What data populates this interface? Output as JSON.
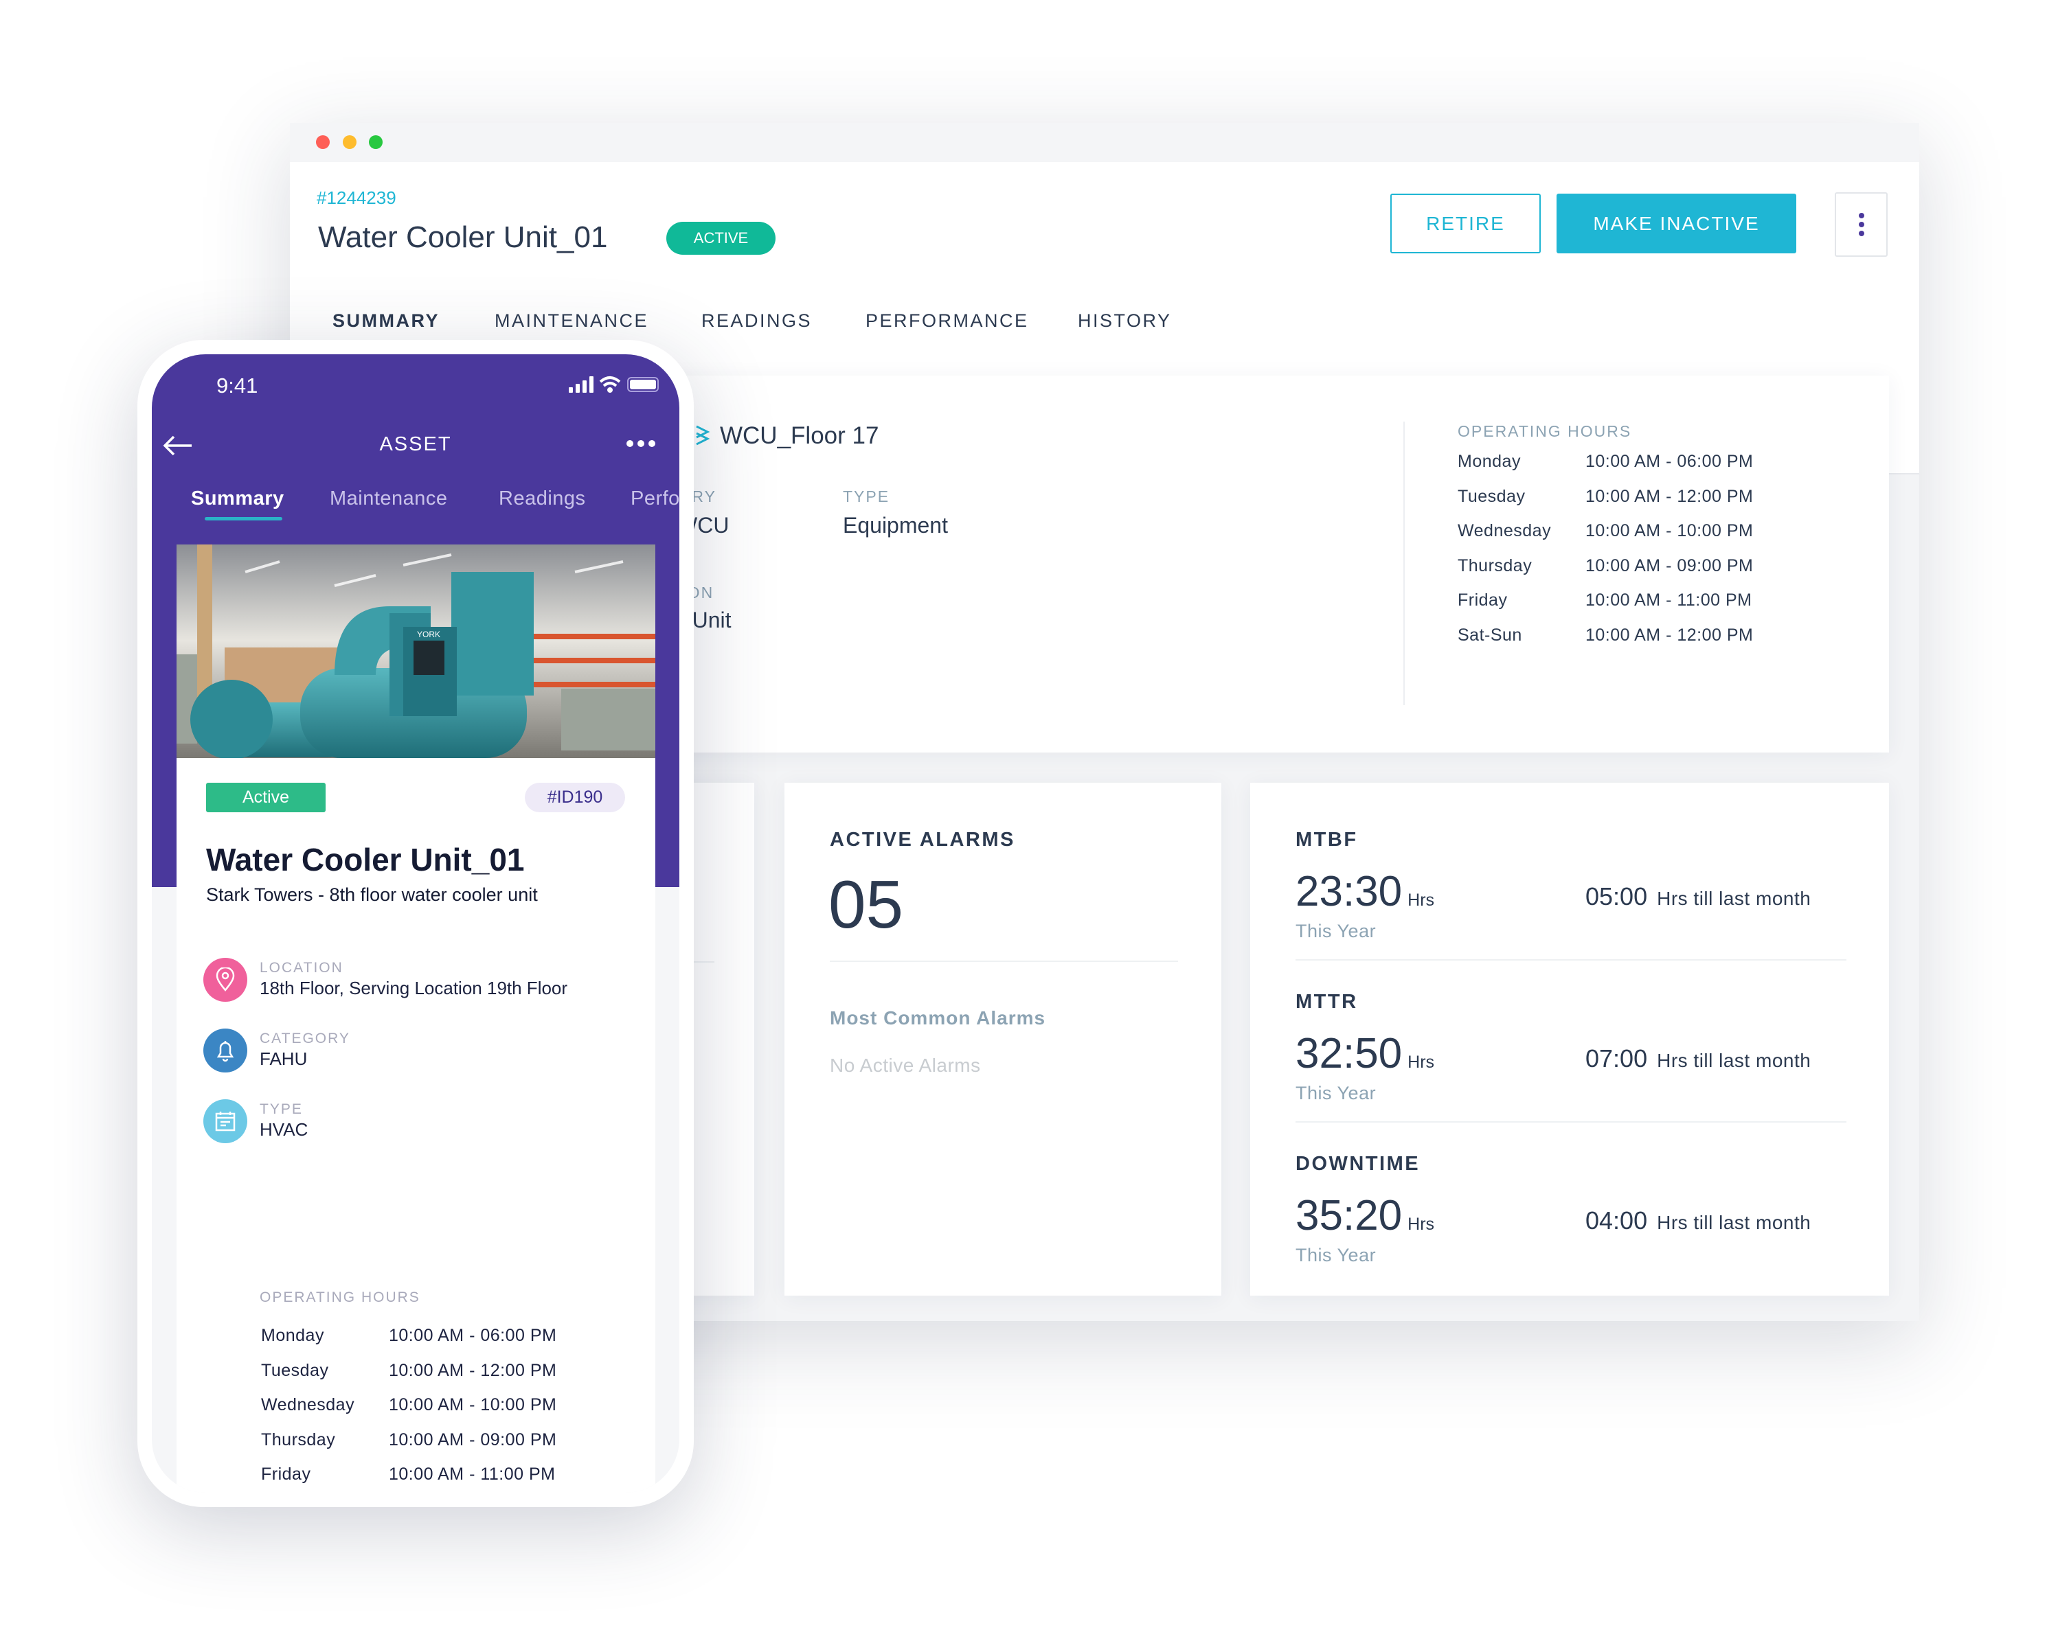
{
  "window": {
    "traffic_lights": [
      "#fe5f57",
      "#febc2e",
      "#28c840"
    ]
  },
  "asset": {
    "id": "#1244239",
    "title": "Water Cooler Unit_01",
    "status": "ACTIVE",
    "status_color": "#10b998"
  },
  "actions": {
    "retire": "RETIRE",
    "make_inactive": "MAKE INACTIVE",
    "accent": "#1fb6d4"
  },
  "tabs": [
    "SUMMARY",
    "MAINTENANCE",
    "READINGS",
    "PERFORMANCE",
    "HISTORY"
  ],
  "info": {
    "name": "WCU_Floor 17",
    "category_label": "CATEGORY",
    "category_value": "WCU",
    "type_label": "TYPE",
    "type_value": "Equipment",
    "description_label": "DESCRIPTION",
    "description_value": "Controller Unit"
  },
  "operating_hours": {
    "label": "OPERATING HOURS",
    "rows": [
      {
        "day": "Monday",
        "time": "10:00 AM - 06:00 PM"
      },
      {
        "day": "Tuesday",
        "time": "10:00 AM - 12:00 PM"
      },
      {
        "day": "Wednesday",
        "time": "10:00 AM - 10:00 PM"
      },
      {
        "day": "Thursday",
        "time": "10:00 AM - 09:00 PM"
      },
      {
        "day": "Friday",
        "time": "10:00 AM - 11:00 PM"
      },
      {
        "day": "Sat-Sun",
        "time": "10:00 AM - 12:00 PM"
      }
    ]
  },
  "alarms": {
    "label": "ACTIVE ALARMS",
    "count": "05",
    "common_label": "Most Common Alarms",
    "empty": "No Active Alarms"
  },
  "metrics": [
    {
      "label": "MTBF",
      "value": "23:30",
      "unit": "Hrs",
      "period": "This Year",
      "delta": "05:00",
      "delta_text": "Hrs till last month"
    },
    {
      "label": "MTTR",
      "value": "32:50",
      "unit": "Hrs",
      "period": "This Year",
      "delta": "07:00",
      "delta_text": "Hrs till last month"
    },
    {
      "label": "DOWNTIME",
      "value": "35:20",
      "unit": "Hrs",
      "period": "This Year",
      "delta": "04:00",
      "delta_text": "Hrs till last month"
    }
  ],
  "mobile": {
    "time": "9:41",
    "title": "ASSET",
    "tabs": [
      "Summary",
      "Maintenance",
      "Readings",
      "Perfo"
    ],
    "status": "Active",
    "id": "#ID190",
    "name": "Water Cooler Unit_01",
    "subtitle": "Stark Towers - 8th floor water cooler unit",
    "fields": [
      {
        "label": "LOCATION",
        "value": "18th Floor, Serving Location 19th Floor",
        "icon": "location-pin-icon",
        "color": "#f0609b"
      },
      {
        "label": "CATEGORY",
        "value": "FAHU",
        "icon": "bell-icon",
        "color": "#3b86c4"
      },
      {
        "label": "TYPE",
        "value": "HVAC",
        "icon": "calendar-icon",
        "color": "#6cc9e6"
      }
    ],
    "hours_label": "OPERATING HOURS",
    "hours_icon_color": "#6b5cab",
    "colors": {
      "header": "#4a389c",
      "tab_underline": "#2ab3c7",
      "active_badge": "#2dbb88"
    }
  }
}
